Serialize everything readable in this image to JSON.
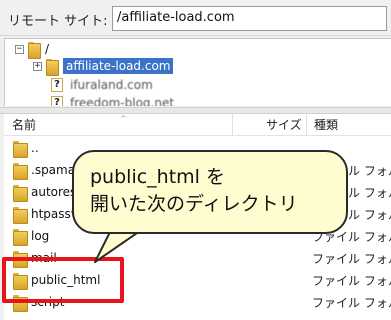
{
  "remote_site": {
    "label": "リモート サイト:",
    "path": "/affiliate-load.com"
  },
  "tree": {
    "root": "/",
    "selected": "affiliate-load.com",
    "items": [
      "ifuraland.com",
      "freedom-blog.net"
    ]
  },
  "columns": {
    "name": "名前",
    "size": "サイズ",
    "type": "種類"
  },
  "files": [
    {
      "name": "..",
      "type": ""
    },
    {
      "name": ".spamassassin",
      "type": "ファイル フォルダ"
    },
    {
      "name": "autoresponder",
      "type": "ファイル フォルダ"
    },
    {
      "name": "htpasswd",
      "type": "ファイル フォルダ"
    },
    {
      "name": "log",
      "type": "ファイル フォルダ"
    },
    {
      "name": "mail",
      "type": "ファイル フォルダ"
    },
    {
      "name": "public_html",
      "type": "ファイル フォルダ"
    },
    {
      "name": "script",
      "type": "ファイル フォルダ"
    }
  ],
  "callout": {
    "line1": "public_html を",
    "line2": "開いた次のディレクトリ"
  },
  "colors": {
    "highlight": "#e8141b",
    "selection": "#3b73c8",
    "callout_bg": "#fffdd0"
  }
}
